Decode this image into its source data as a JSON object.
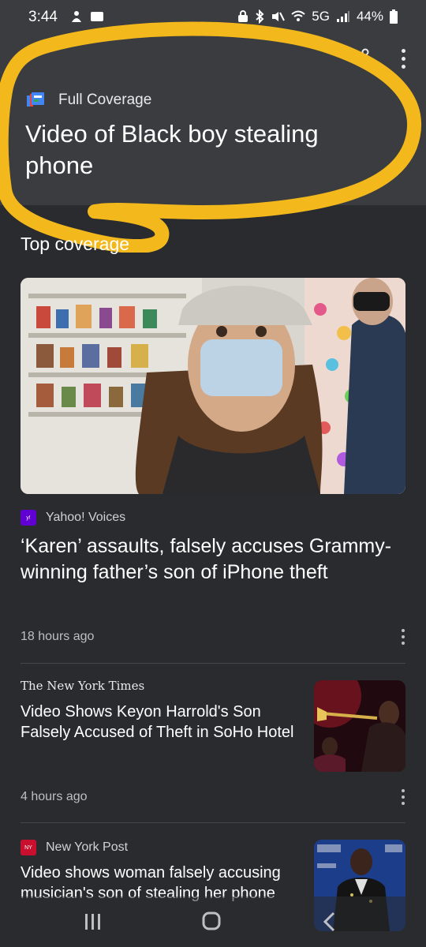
{
  "status_bar": {
    "time": "3:44",
    "network": "5G",
    "battery": "44%"
  },
  "header": {
    "section_label": "Full Coverage",
    "title": "Video of Black boy stealing phone",
    "icons": [
      "share-icon",
      "more-vert-icon",
      "full-coverage-icon"
    ]
  },
  "top_coverage": {
    "heading": "Top coverage",
    "articles": [
      {
        "source": "Yahoo! Voices",
        "headline": "‘Karen’ assaults, falsely accuses Grammy-winning father’s son of iPhone theft",
        "time": "18 hours ago"
      },
      {
        "source": "The New York Times",
        "headline": "Video Shows Keyon Harrold's Son Falsely Accused of Theft in SoHo Hotel",
        "time": "4 hours ago"
      },
      {
        "source": "New York Post",
        "headline": "Video shows woman falsely accusing musician's son of stealing her phone"
      }
    ]
  },
  "colors": {
    "background": "#2a2b2f",
    "header": "#3b3c40",
    "highlight": "#f2b81c"
  }
}
